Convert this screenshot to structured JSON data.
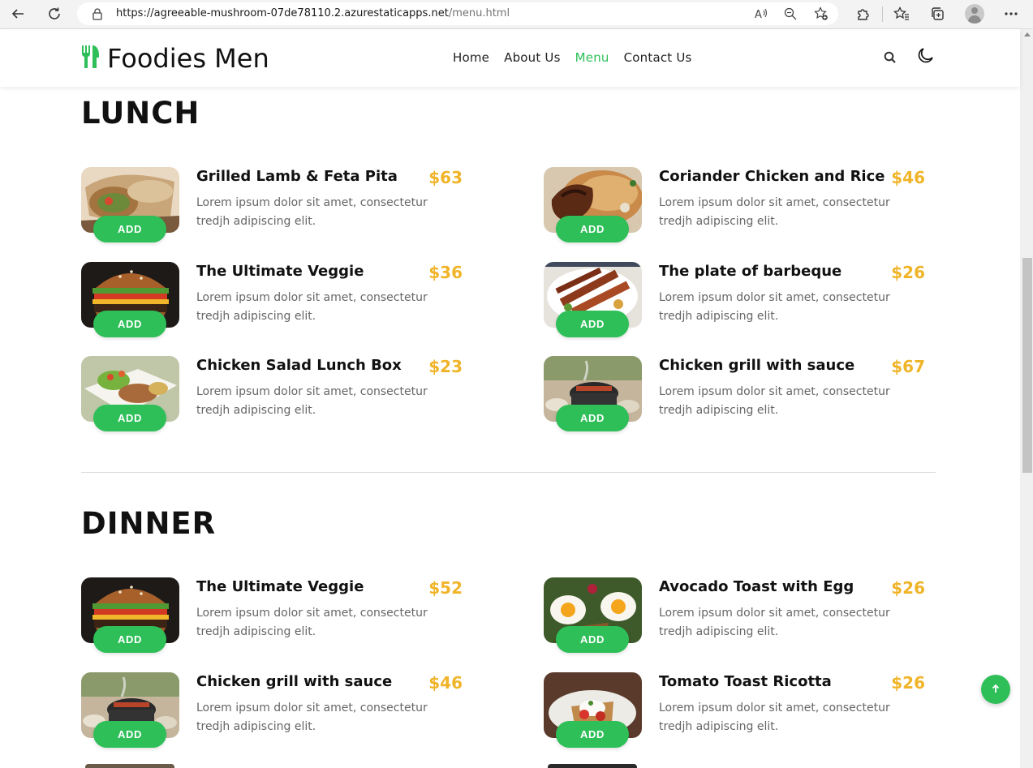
{
  "browser": {
    "url_host": "https://agreeable-mushroom-07de78110.2.azurestaticapps.net",
    "url_path": "/menu.html",
    "icons": [
      "back-icon",
      "refresh-icon",
      "lock-icon",
      "read-aloud-icon",
      "zoom-icon",
      "favorite-add-icon",
      "extensions-icon",
      "favorites-icon",
      "collections-icon",
      "profile-icon",
      "more-icon"
    ]
  },
  "header": {
    "logo_text": "Foodies Men",
    "nav": [
      {
        "label": "Home"
      },
      {
        "label": "About Us"
      },
      {
        "label": "Menu",
        "active": true
      },
      {
        "label": "Contact Us"
      }
    ],
    "accent_color": "#2ebf58"
  },
  "lunch": {
    "title": "LUNCH",
    "items": [
      {
        "name": "Grilled Lamb & Feta Pita",
        "price": "$63",
        "desc": "Lorem ipsum dolor sit amet, consectetur tredjh adipiscing elit.",
        "add": "ADD",
        "image": "wrap"
      },
      {
        "name": "Coriander Chicken and Rice",
        "price": "$46",
        "desc": "Lorem ipsum dolor sit amet, consectetur tredjh adipiscing elit.",
        "add": "ADD",
        "image": "chicken-rice"
      },
      {
        "name": "The Ultimate Veggie",
        "price": "$36",
        "desc": "Lorem ipsum dolor sit amet, consectetur tredjh adipiscing elit.",
        "add": "ADD",
        "image": "burger"
      },
      {
        "name": "The plate of barbeque",
        "price": "$26",
        "desc": "Lorem ipsum dolor sit amet, consectetur tredjh adipiscing elit.",
        "add": "ADD",
        "image": "bbq"
      },
      {
        "name": "Chicken Salad Lunch Box",
        "price": "$23",
        "desc": "Lorem ipsum dolor sit amet, consectetur tredjh adipiscing elit.",
        "add": "ADD",
        "image": "salad"
      },
      {
        "name": "Chicken grill with sauce",
        "price": "$67",
        "desc": "Lorem ipsum dolor sit amet, consectetur tredjh adipiscing elit.",
        "add": "ADD",
        "image": "grill"
      }
    ]
  },
  "dinner": {
    "title": "DINNER",
    "items": [
      {
        "name": "The Ultimate Veggie",
        "price": "$52",
        "desc": "Lorem ipsum dolor sit amet, consectetur tredjh adipiscing elit.",
        "add": "ADD",
        "image": "burger"
      },
      {
        "name": "Avocado Toast with Egg",
        "price": "$26",
        "desc": "Lorem ipsum dolor sit amet, consectetur tredjh adipiscing elit.",
        "add": "ADD",
        "image": "egg-toast"
      },
      {
        "name": "Chicken grill with sauce",
        "price": "$46",
        "desc": "Lorem ipsum dolor sit amet, consectetur tredjh adipiscing elit.",
        "add": "ADD",
        "image": "grill"
      },
      {
        "name": "Tomato Toast Ricotta",
        "price": "$26",
        "desc": "Lorem ipsum dolor sit amet, consectetur tredjh adipiscing elit.",
        "add": "ADD",
        "image": "ricotta"
      }
    ]
  },
  "price_color": "#f0b429"
}
